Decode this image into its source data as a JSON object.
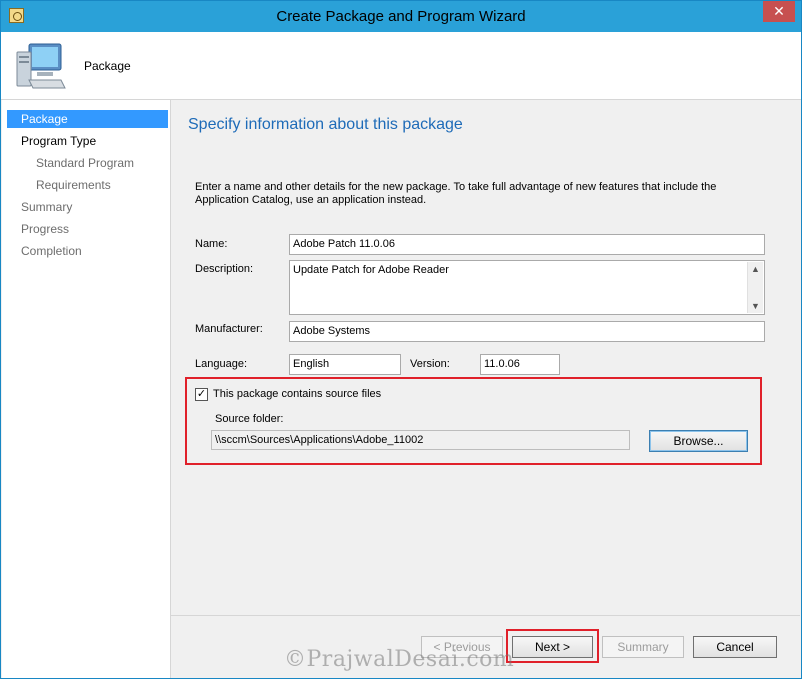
{
  "window": {
    "title": "Create Package and Program Wizard",
    "close": "✕"
  },
  "header": {
    "title": "Package"
  },
  "sidebar": {
    "items": [
      {
        "label": "Package",
        "level": 0,
        "selected": true
      },
      {
        "label": "Program Type",
        "level": 0
      },
      {
        "label": "Standard Program",
        "level": 1
      },
      {
        "label": "Requirements",
        "level": 1
      },
      {
        "label": "Summary",
        "level": 0
      },
      {
        "label": "Progress",
        "level": 0
      },
      {
        "label": "Completion",
        "level": 0
      }
    ]
  },
  "page": {
    "heading": "Specify information about this package",
    "intro": "Enter a name and other details for the new package. To take full advantage of new features that include the Application Catalog, use an application instead."
  },
  "form": {
    "name_label": "Name:",
    "name_value": "Adobe Patch 11.0.06",
    "description_label": "Description:",
    "description_value": "Update Patch for Adobe Reader",
    "manufacturer_label": "Manufacturer:",
    "manufacturer_value": "Adobe Systems",
    "language_label": "Language:",
    "language_value": "English",
    "version_label": "Version:",
    "version_value": "11.0.06",
    "source_checkbox_label": "This package contains source files",
    "source_checked": true,
    "source_folder_label": "Source folder:",
    "source_folder_value": "\\\\sccm\\Sources\\Applications\\Adobe_11002",
    "browse_label": "Browse..."
  },
  "buttons": {
    "previous": "< Previous",
    "next": "Next >",
    "summary": "Summary",
    "cancel": "Cancel"
  },
  "watermark": "©PrajwalDesai.com",
  "colors": {
    "titlebar": "#2aa1d8",
    "selection": "#3399ff",
    "heading": "#1e6bb8",
    "highlight": "#e0202a"
  }
}
